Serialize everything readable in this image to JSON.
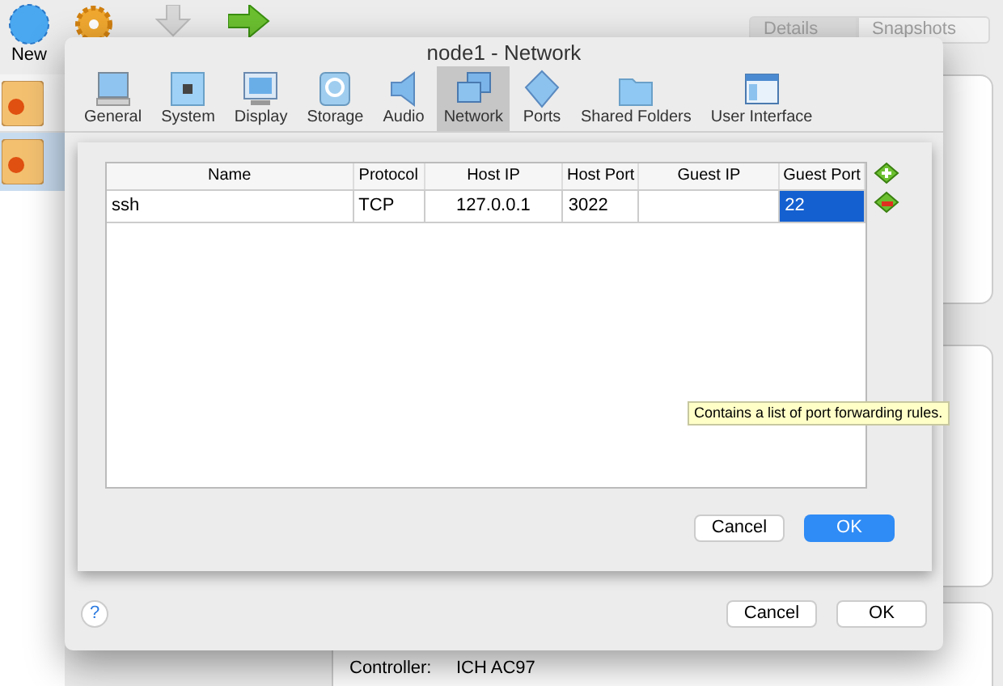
{
  "toolbar": {
    "new_label": "New"
  },
  "view_tabs": [
    {
      "label": "Details",
      "selected": true
    },
    {
      "label": "Snapshots",
      "selected": false
    }
  ],
  "details": [
    {
      "label": "Controller:",
      "value": "ICH AC97"
    }
  ],
  "dialog": {
    "title": "node1 - Network",
    "tabs": [
      {
        "label": "General",
        "selected": false
      },
      {
        "label": "System",
        "selected": false
      },
      {
        "label": "Display",
        "selected": false
      },
      {
        "label": "Storage",
        "selected": false
      },
      {
        "label": "Audio",
        "selected": false
      },
      {
        "label": "Network",
        "selected": true
      },
      {
        "label": "Ports",
        "selected": false
      },
      {
        "label": "Shared Folders",
        "selected": false
      },
      {
        "label": "User Interface",
        "selected": false
      }
    ],
    "help": "?",
    "buttons": [
      "Cancel",
      "OK"
    ]
  },
  "port_forwarding": {
    "columns": [
      "Name",
      "Protocol",
      "Host IP",
      "Host Port",
      "Guest IP",
      "Guest Port"
    ],
    "rows": [
      {
        "cells": [
          {
            "text": "ssh",
            "selected": false
          },
          {
            "text": "TCP",
            "selected": false
          },
          {
            "text": "127.0.0.1",
            "selected": false
          },
          {
            "text": "3022",
            "selected": false
          },
          {
            "selected": false
          },
          {
            "text": "22",
            "selected": true
          }
        ]
      }
    ],
    "tooltip": "Contains a list of port forwarding rules.",
    "buttons": [
      {
        "label": "Cancel",
        "kind": "default"
      },
      {
        "label": "OK",
        "kind": "primary"
      }
    ]
  }
}
